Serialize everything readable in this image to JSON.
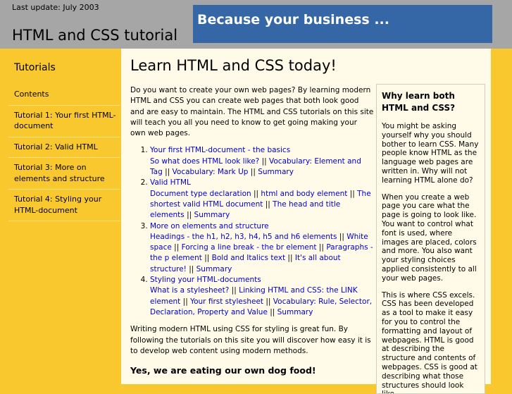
{
  "header": {
    "last_update": "Last update: July 2003",
    "site_title": "HTML and CSS tutorial",
    "banner_text": "Because your business ..."
  },
  "sidebar": {
    "heading": "Tutorials",
    "items": [
      "Contents",
      "Tutorial 1: Your first HTML-document",
      "Tutorial 2: Valid HTML",
      "Tutorial 3: More on elements and structure",
      "Tutorial 4: Styling your HTML-document"
    ]
  },
  "main": {
    "title": "Learn HTML and CSS today!",
    "intro": "Do you want to create your own web pages? By learning modern HTML and CSS you can create web pages that both look good and are easy to maintain. The HTML and CSS tutorials on this site will teach you all you need to know to get going making your own web pages.",
    "tutorials": [
      {
        "title": "Your first HTML-document - the basics",
        "links": [
          "So what does HTML look like?",
          "Vocabulary: Element and Tag",
          "Vocabulary: Mark Up",
          "Summary"
        ]
      },
      {
        "title": "Valid HTML",
        "links": [
          "Document type declaration",
          "html and body element",
          "The shortest valid HTML document",
          "The head and title elements",
          "Summary"
        ]
      },
      {
        "title": "More on elements and structure",
        "links": [
          "Headings - the h1, h2, h3, h4, h5 and h6 elements",
          "White space",
          "Forcing a line break - the br element",
          "Paragraphs - the p element",
          "Bold and Italics text",
          "It's all about structure!",
          "Summary"
        ]
      },
      {
        "title": "Styling your HTML-documents",
        "links": [
          "What is a stylesheet?",
          "Linking HTML and CSS: the LINK element",
          "Your first stylesheet",
          "Vocabulary: Rule, Selector, Declaration, Property and Value",
          "Summary"
        ]
      }
    ],
    "separator": " || ",
    "outro": "Writing modern HTML using CSS for styling is great fun. By following the tutorials on this site you will discover how easy it is to develop web content using modern methods.",
    "dogfood_heading": "Yes, we are eating our own dog food!"
  },
  "aside": {
    "heading": "Why learn both HTML and CSS?",
    "paragraphs": [
      "You might be asking yourself why you should bother to learn CSS. Many people know HTML as the language web pages are written in. Why will not learning HTML alone do?",
      "When you create a web page you care what the page is going to look like. You want to control what font is used, where images are placed, colors and more. You also want your styling choices applied consistently to all your web pages.",
      "This is where CSS excels. CSS has been developed as a tool to make it easy for you to control the formatting and layout of webpages. HTML is good at describing the structure and contents of webpages. CSS is good at describing what those structures should look like."
    ]
  },
  "colors": {
    "page_background": "#f9c82f",
    "header_background": "#a6a6a6",
    "banner_background": "#3567a6",
    "content_background": "#fffbe8",
    "link": "#0000cc"
  }
}
